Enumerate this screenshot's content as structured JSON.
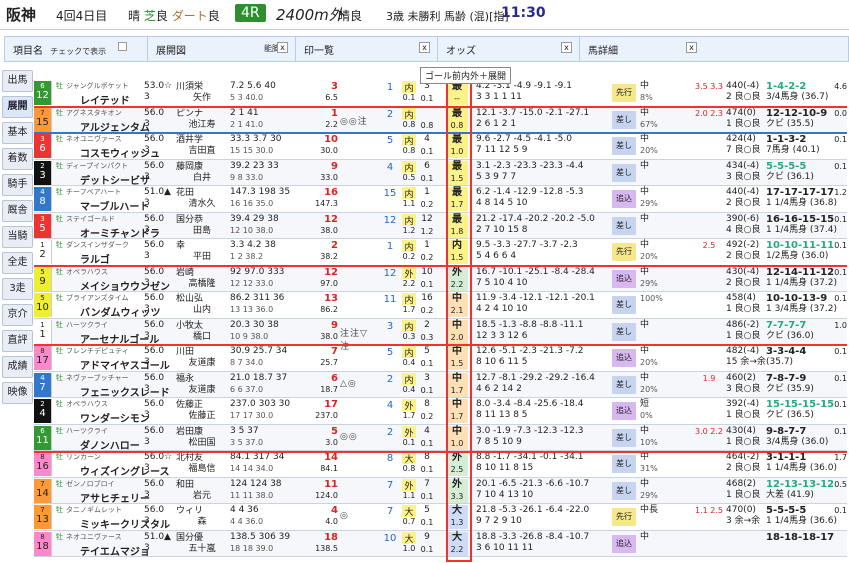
{
  "title": {
    "venue": "阪神",
    "meeting": "4回4日目",
    "weather_label": "晴",
    "turf_label": "芝",
    "turf_cond": "良",
    "dirt_label": "ダート",
    "dirt_cond": "良",
    "race_no": "4R",
    "course": "2400m外",
    "course_weather": "晴良",
    "conditions": "3歳 未勝利 馬齢 (混)[指]",
    "post_time": "11:30"
  },
  "header": {
    "s1": "項目名",
    "s1_check": "チェックで表示",
    "s2": "展開図",
    "s2_extra": "能脚",
    "s3": "印一覧",
    "s4": "オッズ",
    "s5": "馬詳細",
    "close": "x"
  },
  "floating_label": "ゴール前内外＋展開",
  "sidebar": [
    "出馬",
    "展開",
    "基本",
    "着数",
    "騎手",
    "厩舎",
    "当騎",
    "全走",
    "3走",
    "京介",
    "直評",
    "成績",
    "映像"
  ],
  "sidebar_active": 1,
  "horses": [
    {
      "waku": "6",
      "no": "12",
      "sire": "ジャングルポケット",
      "sex": "牡",
      "name": "レイテッド",
      "jk1": "53.0☆",
      "jk2": "3",
      "jockey": "川須栄",
      "jockey_name": "矢作",
      "sp": "7.2 5.6 40",
      "sp2": "5 3 40.0",
      "odds": "6.5",
      "pop": "3",
      "mark": "",
      "p": "1",
      "q": "内",
      "qv": "0.1",
      "r": "3",
      "rv": "0.1",
      "pos": "最",
      "posv": "--",
      "spl": "4.2 -3.1 -4.9 -9.1 -9.1",
      "spl2": "3 3 1 1 11",
      "style": "先行",
      "rate": "中",
      "rate2": "8%",
      "mr": "3.5 3.3",
      "bw": "440(-4)",
      "bw2": "2 良○良",
      "rc": "1-4-2-2",
      "rc2": "3/4馬身 (36.7)",
      "pt": "4.6"
    },
    {
      "waku": "7",
      "no": "15",
      "sire": "アグネスタキオン",
      "sex": "牡",
      "name": "アルジェンタム",
      "jk1": "56.0",
      "jk2": "3",
      "jockey": "ピンナ",
      "jockey_name": "池江寿",
      "sp": "2 1 41",
      "sp2": "2 1 41.0",
      "odds": "2.2",
      "pop": "1",
      "mark": "◎◎注",
      "p": "2",
      "q": "内",
      "qv": "0.8",
      "r": "",
      "rv": "0.8",
      "pos": "最",
      "posv": "0.8",
      "spl": "12.1 -3.7 -15.0 -2.1 -27.1",
      "spl2": "2 6 1 2 1",
      "style": "差し",
      "rate": "中",
      "rate2": "67%",
      "mr": "2.0 2.3",
      "bw": "474(0)",
      "bw2": "1 良○良",
      "rc": "12-12-10-9",
      "rc2": "クビ (35.5)",
      "pt": "0.0"
    },
    {
      "waku": "3",
      "no": "6",
      "sire": "ネオユニヴァース",
      "sex": "牡",
      "name": "コスモウィッシュ",
      "jk1": "56.0",
      "jk2": "3",
      "jockey": "酒井学",
      "jockey_name": "吉田直",
      "sp": "33.3 3.7 30",
      "sp2": "15 15 30.0",
      "odds": "30.0",
      "pop": "10",
      "mark": "",
      "p": "5",
      "q": "内",
      "qv": "0.8",
      "r": "4",
      "rv": "0.1",
      "pos": "最",
      "posv": "1.0",
      "spl": "9.6 -2.7 -4.5 -4.1 -5.0",
      "spl2": "7 11 12 5 9",
      "style": "差し",
      "rate": "中",
      "rate2": "20%",
      "mr": "",
      "bw": "424(4)",
      "bw2": "7 良○良",
      "rc": "1-1-3-2",
      "rc2": "7馬身 (40.1)",
      "pt": "0.1"
    },
    {
      "waku": "2",
      "no": "3",
      "sire": "ディープインパクト",
      "sex": "牡",
      "name": "デットシービサ",
      "jk1": "56.0",
      "jk2": "3",
      "jockey": "藤岡康",
      "jockey_name": "白井",
      "sp": "39.2 23 33",
      "sp2": "9 8 33.0",
      "odds": "33.0",
      "pop": "9",
      "mark": "",
      "p": "4",
      "q": "内",
      "qv": "0.5",
      "r": "6",
      "rv": "0.1",
      "pos": "最",
      "posv": "1.5",
      "spl": "3.1 -2.3 -23.3 -23.3 -4.4",
      "spl2": "5 3 9 7 7",
      "style": "差し",
      "rate": "中",
      "rate2": "",
      "mr": "",
      "bw": "434(-4)",
      "bw2": "3 良○良",
      "rc": "5-5-5-5",
      "rc2": "クビ (36.1)",
      "pt": "0.1"
    },
    {
      "waku": "4",
      "no": "8",
      "sire": "チーフベアハート",
      "sex": "牡",
      "name": "マーブルハート",
      "jk1": "51.0▲",
      "jk2": "3",
      "jockey": "花田",
      "jockey_name": "清水久",
      "sp": "147.3 198 35",
      "sp2": "16 16 35.0",
      "odds": "147.3",
      "pop": "16",
      "mark": "",
      "p": "15",
      "q": "内",
      "qv": "1.1",
      "r": "1",
      "rv": "0.2",
      "pos": "最",
      "posv": "1.7",
      "spl": "6.2 -1.4 -12.9 -12.8 -5.3",
      "spl2": "4 8 14 5 10",
      "style": "追込",
      "rate": "中",
      "rate2": "29%",
      "mr": "",
      "bw": "440(-4)",
      "bw2": "2 良○良",
      "rc": "17-17-17-17",
      "rc2": "1 1/4馬身 (36.8)",
      "pt": "1.2"
    },
    {
      "waku": "3",
      "no": "5",
      "sire": "ステイゴールド",
      "sex": "牡",
      "name": "オーミチャンドラ",
      "jk1": "56.0",
      "jk2": "3",
      "jockey": "国分恭",
      "jockey_name": "田島",
      "sp": "39.4 29 38",
      "sp2": "12 10 38.0",
      "odds": "38.0",
      "pop": "12",
      "mark": "",
      "p": "12",
      "q": "内",
      "qv": "1.2",
      "r": "12",
      "rv": "1.2",
      "pos": "最",
      "posv": "1.8",
      "spl": "21.2 -17.4 -20.2 -20.2 -5.0",
      "spl2": "2 7 10 15 8",
      "style": "差し",
      "rate": "中",
      "rate2": "",
      "mr": "",
      "bw": "390(-6)",
      "bw2": "4 良○良",
      "rc": "16-16-15-15",
      "rc2": "1 1/4馬身 (37.4)",
      "pt": "0.1"
    },
    {
      "waku": "1",
      "no": "2",
      "sire": "ダンスインザダーク",
      "sex": "牡",
      "name": "ラルゴ",
      "jk1": "56.0",
      "jk2": "3",
      "jockey": "幸",
      "jockey_name": "平田",
      "sp": "3.3 4.2 38",
      "sp2": "1 2 38.2",
      "odds": "38.2",
      "pop": "2",
      "mark": "",
      "p": "1",
      "q": "内",
      "qv": "0.2",
      "r": "1",
      "rv": "0.2",
      "pos": "内",
      "posv": "1.5",
      "spl": "9.5 -3.3 -27.7 -3.7 -2.3",
      "spl2": "5 4 6 6 4",
      "style": "先行",
      "rate": "中",
      "rate2": "20%",
      "mr": "2.5",
      "bw": "492(-2)",
      "bw2": "2 良○良",
      "rc": "10-10-11-11",
      "rc2": "1/2馬身 (36.0)",
      "pt": "0.1"
    },
    {
      "waku": "5",
      "no": "9",
      "sire": "オペラハウス",
      "sex": "牡",
      "name": "メイショウウンゼン",
      "jk1": "56.0",
      "jk2": "3",
      "jockey": "岩崎",
      "jockey_name": "高橋隆",
      "sp": "92 97.0 333",
      "sp2": "12 12 33.0",
      "odds": "97.0",
      "pop": "12",
      "mark": "",
      "p": "12",
      "q": "外",
      "qv": "2.2",
      "r": "10",
      "rv": "0.1",
      "pos": "外",
      "posv": "2.2",
      "spl": "16.7 -10.1 -25.1 -8.4 -28.4",
      "spl2": "7 5 10 4 10",
      "style": "追込",
      "rate": "中",
      "rate2": "29%",
      "mr": "",
      "bw": "430(-4)",
      "bw2": "2 良○良",
      "rc": "12-14-11-12",
      "rc2": "1 1/4馬身 (37.2)",
      "pt": "0.1"
    },
    {
      "waku": "5",
      "no": "10",
      "sire": "ブライアンズタイム",
      "sex": "牡",
      "name": "バンダムウィッツ",
      "jk1": "56.0",
      "jk2": "3",
      "jockey": "松山弘",
      "jockey_name": "山内",
      "sp": "86.2 311 36",
      "sp2": "13 13 36.0",
      "odds": "86.2",
      "pop": "13",
      "mark": "",
      "p": "11",
      "q": "内",
      "qv": "1.7",
      "r": "16",
      "rv": "0.2",
      "pos": "中",
      "posv": "2.1",
      "spl": "11.9 -3.4 -12.1 -12.1 -20.1",
      "spl2": "4 2 4 10 10",
      "style": "差し",
      "rate": "",
      "rate2": "100%",
      "mr": "",
      "bw": "458(4)",
      "bw2": "1 良○良",
      "rc": "10-10-13-9",
      "rc2": "1 3/4馬身 (37.2)",
      "pt": "0.1"
    },
    {
      "waku": "1",
      "no": "1",
      "sire": "ハーツクライ",
      "sex": "牡",
      "name": "アーセナルゴール",
      "jk1": "56.0",
      "jk2": "3",
      "jockey": "小牧太",
      "jockey_name": "橋口",
      "sp": "20.3 30 38",
      "sp2": "10 9 38.0",
      "odds": "38.0",
      "pop": "9",
      "mark": "注注▽注",
      "p": "3",
      "q": "内",
      "qv": "0.3",
      "r": "2",
      "rv": "0.3",
      "pos": "中",
      "posv": "2.0",
      "spl": "18.5 -1.3 -8.8 -8.8 -11.1",
      "spl2": "12 3 3 12 6",
      "style": "差し",
      "rate": "中",
      "rate2": "",
      "mr": "",
      "bw": "486(-2)",
      "bw2": "1 良○良",
      "rc": "7-7-7-7",
      "rc2": "クビ (36.0)",
      "pt": "1.0"
    },
    {
      "waku": "8",
      "no": "17",
      "sire": "フレンチデピュティ",
      "sex": "牡",
      "name": "アドマイヤスコール",
      "jk1": "56.0",
      "jk2": "3",
      "jockey": "川田",
      "jockey_name": "友道康",
      "sp": "30.9 25.7 34",
      "sp2": "8 7 34.0",
      "odds": "25.7",
      "pop": "7",
      "mark": "",
      "p": "5",
      "q": "内",
      "qv": "0.4",
      "r": "5",
      "rv": "0.1",
      "pos": "中",
      "posv": "1.5",
      "spl": "12.6 -5.1 -2.3 -21.3 -7.2",
      "spl2": "8 10 6 11 5",
      "style": "追込",
      "rate": "中",
      "rate2": "20%",
      "mr": "",
      "bw": "482(-4)",
      "bw2": "15 余→余",
      "rc": "3-3-4-4",
      "rc2": "(35.7)",
      "pt": "0.1"
    },
    {
      "waku": "4",
      "no": "7",
      "sire": "ネヴァーブッチャー",
      "sex": "牡",
      "name": "フェニックスレード",
      "jk1": "56.0",
      "jk2": "3",
      "jockey": "福永",
      "jockey_name": "友道康",
      "sp": "21.0 18.7 37",
      "sp2": "6 6 37.0",
      "odds": "18.7",
      "pop": "6",
      "mark": "△◎",
      "p": "2",
      "q": "内",
      "qv": "0.4",
      "r": "3",
      "rv": "0.1",
      "pos": "中",
      "posv": "1.7",
      "spl": "12.7 -8.1 -29.2 -29.2 -16.4",
      "spl2": "4 6 2 14 2",
      "style": "差し",
      "rate": "中",
      "rate2": "20%",
      "mr": "1.9",
      "bw": "460(2)",
      "bw2": "3 良○良",
      "rc": "7-8-7-9",
      "rc2": "クビ (35.9)",
      "pt": "0.1"
    },
    {
      "waku": "2",
      "no": "4",
      "sire": "オペラハウス",
      "sex": "牡",
      "name": "ワンダーシモン",
      "jk1": "56.0",
      "jk2": "3",
      "jockey": "佐藤正",
      "jockey_name": "佐藤正",
      "sp": "237.0 303 30",
      "sp2": "17 17 30.0",
      "odds": "237.0",
      "pop": "17",
      "mark": "",
      "p": "4",
      "q": "外",
      "qv": "1.7",
      "r": "8",
      "rv": "0.2",
      "pos": "中",
      "posv": "1.7",
      "spl": "8.0 -3.4 -8.4 -25.6 -18.4",
      "spl2": "8 11 13 8 5",
      "style": "追込",
      "rate": "短",
      "rate2": "0%",
      "mr": "",
      "bw": "392(-4)",
      "bw2": "1 良○良",
      "rc": "15-15-15-15",
      "rc2": "クビ (36.5)",
      "pt": "0.1"
    },
    {
      "waku": "6",
      "no": "11",
      "sire": "ハーツクライ",
      "sex": "牡",
      "name": "ダノンハロー",
      "jk1": "56.0",
      "jk2": "3",
      "jockey": "岩田康",
      "jockey_name": "松田国",
      "sp": "3 5 37",
      "sp2": "3 5 37.0",
      "odds": "3.0",
      "pop": "5",
      "mark": "◎◎",
      "p": "2",
      "q": "外",
      "qv": "0.1",
      "r": "4",
      "rv": "0.1",
      "pos": "中",
      "posv": "1.0",
      "spl": "3.0 -1.9 -7.3 -12.3 -12.3",
      "spl2": "7 8 5 10 9",
      "style": "差し",
      "rate": "中",
      "rate2": "10%",
      "mr": "3.0 2.2",
      "bw": "430(4)",
      "bw2": "1 良○良",
      "rc": "9-8-7-7",
      "rc2": "3/4馬身 (36.0)",
      "pt": "0.1"
    },
    {
      "waku": "8",
      "no": "16",
      "sire": "リンカーン",
      "sex": "牡",
      "name": "ウィズイングレース",
      "jk1": "56.0☆",
      "jk2": "3",
      "jockey": "北村友",
      "jockey_name": "福島信",
      "sp": "84.1 317 34",
      "sp2": "14 14 34.0",
      "odds": "84.1",
      "pop": "14",
      "mark": "",
      "p": "8",
      "q": "大",
      "qv": "0.8",
      "r": "8",
      "rv": "0.1",
      "pos": "外",
      "posv": "2.5",
      "spl": "8.8 -1.7 -34.1 -0.1 -34.1",
      "spl2": "8 10 11 8 15",
      "style": "差し",
      "rate": "中",
      "rate2": "31%",
      "mr": "",
      "bw": "464(-2)",
      "bw2": "2 良○良",
      "rc": "3-1-1-1",
      "rc2": "1 1/4馬身 (36.0)",
      "pt": "1.7"
    },
    {
      "waku": "7",
      "no": "14",
      "sire": "ゼンノロブロイ",
      "sex": "牡",
      "name": "アサヒチェリー",
      "jk1": "56.0",
      "jk2": "3",
      "jockey": "和田",
      "jockey_name": "岩元",
      "sp": "124 124 38",
      "sp2": "11 11 38.0",
      "odds": "124.0",
      "pop": "11",
      "mark": "",
      "p": "7",
      "q": "外",
      "qv": "1.1",
      "r": "7",
      "rv": "0.1",
      "pos": "外",
      "posv": "3.3",
      "spl": "20.1 -6.5 -21.3 -6.6 -10.7",
      "spl2": "7 10 4 13 10",
      "style": "差し",
      "rate": "中",
      "rate2": "29%",
      "mr": "",
      "bw": "468(2)",
      "bw2": "1 良○良",
      "rc": "12-13-13-12",
      "rc2": "大差 (41.9)",
      "pt": "0.5"
    },
    {
      "waku": "7",
      "no": "13",
      "sire": "タニノギムレット",
      "sex": "牡",
      "name": "ミッキークリスタル",
      "jk1": "56.0",
      "jk2": "3",
      "jockey": "ウィリ",
      "jockey_name": "森",
      "sp": "4 4 36",
      "sp2": "4 4 36.0",
      "odds": "4.0",
      "pop": "4",
      "mark": "◎",
      "p": "7",
      "q": "大",
      "qv": "0.7",
      "r": "5",
      "rv": "0.1",
      "pos": "大",
      "posv": "1.3",
      "spl": "21.8 -5.3 -26.1 -6.4 -22.0",
      "spl2": "9 7 2 9 10",
      "style": "先行",
      "rate": "中長",
      "rate2": "",
      "mr": "1.1 2.5",
      "bw": "470(0)",
      "bw2": "3 余→余",
      "rc": "5-5-5-5",
      "rc2": "1 1/4馬身 (36.6)",
      "pt": "0.1"
    },
    {
      "waku": "8",
      "no": "18",
      "sire": "ネオユニヴァース",
      "sex": "牡",
      "name": "テイエムマジョ",
      "jk1": "51.0▲",
      "jk2": "3",
      "jockey": "国分優",
      "jockey_name": "五十嵐",
      "sp": "138.5 306 39",
      "sp2": "18 18 39.0",
      "odds": "138.5",
      "pop": "18",
      "mark": "",
      "p": "10",
      "q": "大",
      "qv": "1.0",
      "r": "9",
      "rv": "0.1",
      "pos": "大",
      "posv": "2.2",
      "spl": "18.8 -3.3 -26.8 -8.4 -10.7",
      "spl2": "3 6 10 11 11",
      "style": "追込",
      "rate": "中",
      "rate2": "",
      "mr": "",
      "bw": "",
      "bw2": "",
      "rc": "18-18-18-17",
      "rc2": "",
      "pt": ""
    }
  ]
}
